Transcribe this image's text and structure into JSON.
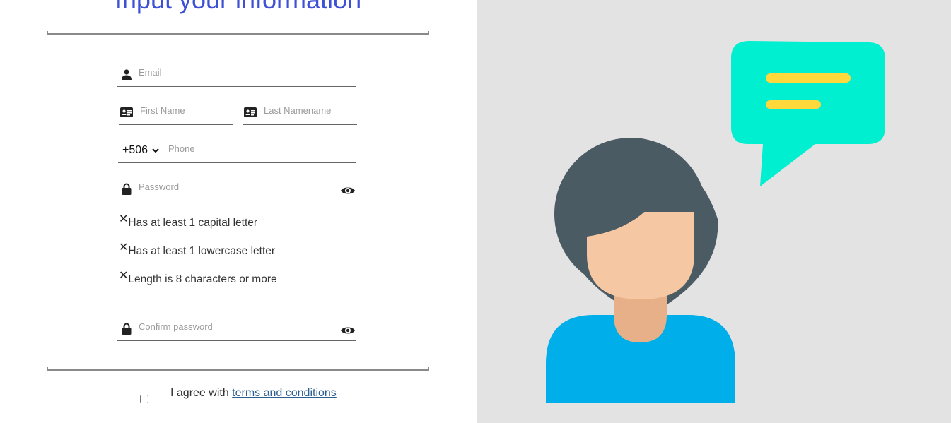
{
  "page": {
    "title": "Input your information"
  },
  "form": {
    "email": {
      "placeholder": "Email",
      "value": ""
    },
    "first_name": {
      "placeholder": "First Name",
      "value": ""
    },
    "last_name": {
      "placeholder": "Last Namename",
      "value": ""
    },
    "phone": {
      "country_code": "+506",
      "placeholder": "Phone",
      "value": ""
    },
    "password": {
      "placeholder": "Password",
      "value": ""
    },
    "confirm_password": {
      "placeholder": "Confirm password",
      "value": ""
    }
  },
  "password_rules": [
    {
      "mark": "✕",
      "text": "Has at least 1 capital letter",
      "met": false
    },
    {
      "mark": "✕",
      "text": "Has at least 1 lowercase letter",
      "met": false
    },
    {
      "mark": "✕",
      "text": "Length is 8 characters or more",
      "met": false
    }
  ],
  "agreement": {
    "prefix": "I agree with",
    "link_text": "terms and conditions",
    "checked": false
  },
  "icons": {
    "email": "user-icon",
    "first_name": "id-card-icon",
    "last_name": "id-card-icon",
    "phone_dropdown": "chevron-down-icon",
    "password": "lock-icon",
    "password_toggle": "eye-icon",
    "confirm_password": "lock-icon",
    "confirm_toggle": "eye-icon",
    "rule_status": "close-icon"
  },
  "colors": {
    "title": "#3d50d6",
    "link": "#2c5e91",
    "illustration_bg": "#e3e3e3",
    "hair": "#4b5b63",
    "skin": "#f5c8a3",
    "neck": "#e8b088",
    "shirt": "#00aee9",
    "bubble": "#00efd0",
    "bubble_lines": "#ffd83b"
  }
}
